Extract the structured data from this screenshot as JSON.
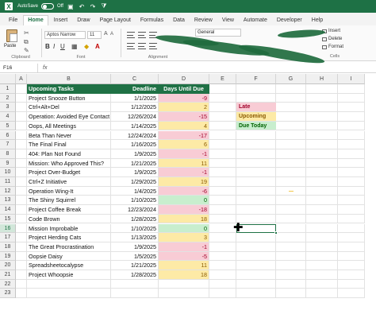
{
  "titlebar": {
    "app_letter": "X",
    "autosave_label": "AutoSave",
    "toggle_state": "Off",
    "quick_icons": [
      "save-icon",
      "undo-icon",
      "redo-icon",
      "filter-icon"
    ]
  },
  "menu": {
    "tabs": [
      "File",
      "Home",
      "Insert",
      "Draw",
      "Page Layout",
      "Formulas",
      "Data",
      "Review",
      "View",
      "Automate",
      "Developer",
      "Help"
    ],
    "active": "Home"
  },
  "ribbon": {
    "clipboard_label": "Clipboard",
    "paste_label": "Paste",
    "font_label": "Font",
    "font_name": "Aptos Narrow",
    "font_size": "11",
    "alignment_label": "Alignment",
    "number_format": "General",
    "cells_label": "Cells",
    "insert_label": "Insert",
    "delete_label": "Delete",
    "format_label": "Format"
  },
  "formula_bar": {
    "name_box": "F16",
    "fx": "fx"
  },
  "grid": {
    "columns": [
      "A",
      "B",
      "C",
      "D",
      "E",
      "F",
      "G",
      "H",
      "I"
    ],
    "rows": [
      "1",
      "2",
      "3",
      "4",
      "5",
      "6",
      "7",
      "8",
      "9",
      "10",
      "11",
      "12",
      "13",
      "14",
      "15",
      "16",
      "17",
      "18",
      "19",
      "20",
      "21",
      "22",
      "23"
    ],
    "selected_row": "16",
    "headers": {
      "task": "Upcoming Tasks",
      "deadline": "Deadline",
      "days": "Days Until Due"
    },
    "tasks": [
      {
        "name": "Project Snooze Button",
        "deadline": "1/1/2025",
        "days": "-9",
        "status": "late"
      },
      {
        "name": "Ctrl+Alt+Del",
        "deadline": "1/12/2025",
        "days": "2",
        "status": "upcoming"
      },
      {
        "name": "Operation: Avoided Eye Contact",
        "deadline": "12/26/2024",
        "days": "-15",
        "status": "late"
      },
      {
        "name": "Oops, All Meetings",
        "deadline": "1/14/2025",
        "days": "4",
        "status": "upcoming"
      },
      {
        "name": "Beta Than Never",
        "deadline": "12/24/2024",
        "days": "-17",
        "status": "late"
      },
      {
        "name": "The Final Final",
        "deadline": "1/16/2025",
        "days": "6",
        "status": "upcoming"
      },
      {
        "name": "404: Plan Not Found",
        "deadline": "1/9/2025",
        "days": "-1",
        "status": "late"
      },
      {
        "name": "Mission: Who Approved This?",
        "deadline": "1/21/2025",
        "days": "11",
        "status": "upcoming"
      },
      {
        "name": "Project Over-Budget",
        "deadline": "1/9/2025",
        "days": "-1",
        "status": "late"
      },
      {
        "name": "Ctrl+Z Initiative",
        "deadline": "1/29/2025",
        "days": "19",
        "status": "upcoming"
      },
      {
        "name": "Operation Wing-It",
        "deadline": "1/4/2025",
        "days": "-6",
        "status": "late"
      },
      {
        "name": "The Shiny Squirrel",
        "deadline": "1/10/2025",
        "days": "0",
        "status": "duetoday"
      },
      {
        "name": "Project Coffee Break",
        "deadline": "12/23/2024",
        "days": "-18",
        "status": "late"
      },
      {
        "name": "Code Brown",
        "deadline": "1/28/2025",
        "days": "18",
        "status": "upcoming"
      },
      {
        "name": "Mission Improbable",
        "deadline": "1/10/2025",
        "days": "0",
        "status": "duetoday"
      },
      {
        "name": "Project Herding Cats",
        "deadline": "1/13/2025",
        "days": "3",
        "status": "upcoming"
      },
      {
        "name": "The Great Procrastination",
        "deadline": "1/9/2025",
        "days": "-1",
        "status": "late"
      },
      {
        "name": "Oopsie Daisy",
        "deadline": "1/5/2025",
        "days": "-5",
        "status": "late"
      },
      {
        "name": "Spreadsheetocalypse",
        "deadline": "1/21/2025",
        "days": "11",
        "status": "upcoming"
      },
      {
        "name": "Project Whoopsie",
        "deadline": "1/28/2025",
        "days": "18",
        "status": "upcoming"
      }
    ],
    "legend": [
      {
        "label": "Late",
        "status": "late"
      },
      {
        "label": "Upcoming",
        "status": "upcoming"
      },
      {
        "label": "Due Today",
        "status": "duetoday"
      }
    ]
  },
  "colors": {
    "header_green": "#1f7145",
    "late_fill": "#f8ccd5",
    "upcoming_fill": "#fdeaa6",
    "duetoday_fill": "#c8eece"
  }
}
